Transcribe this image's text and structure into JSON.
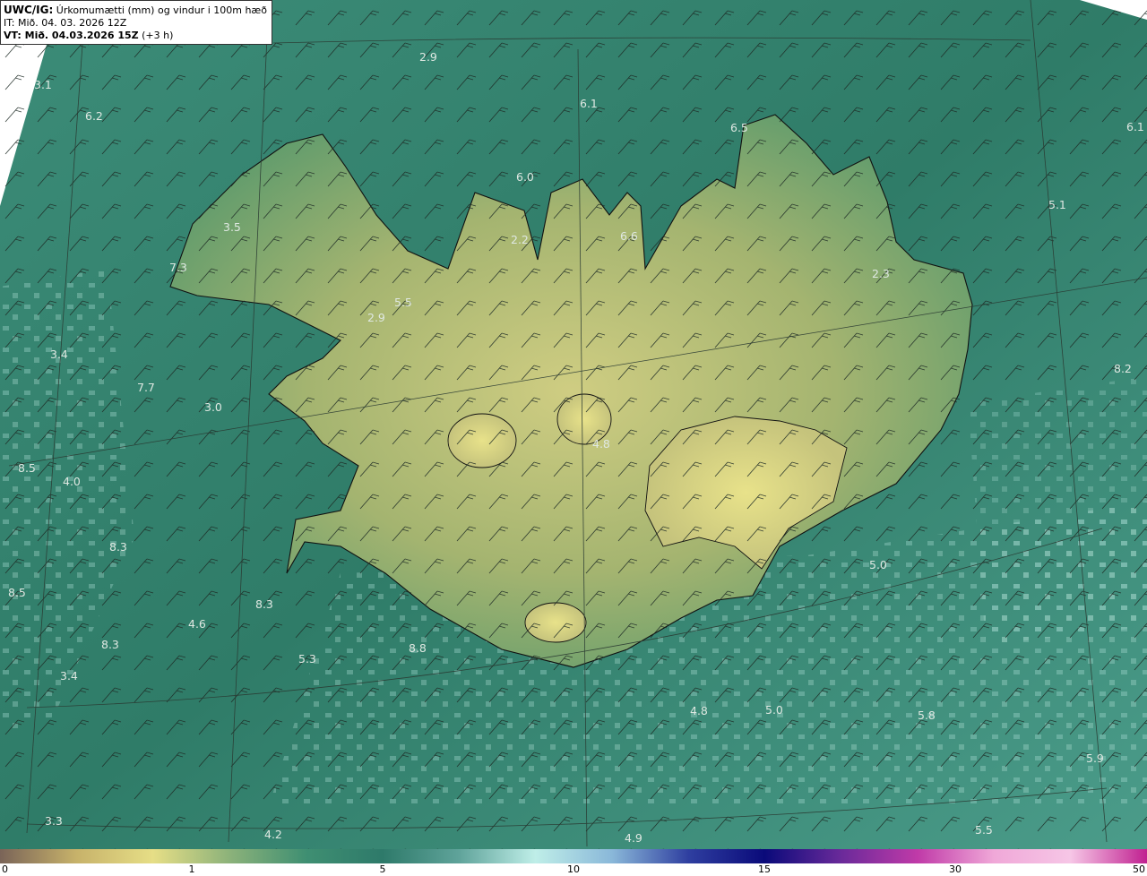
{
  "header": {
    "model": "UWC/IG:",
    "description": "Úrkomumætti (mm) og vindur i 100m hæð",
    "init_time": "IT: Mið. 04. 03. 2026 12Z",
    "valid_prefix": "VT: Mið. 04.03.2026 15Z",
    "valid_suffix": "(+3 h)"
  },
  "map_values": [
    "3.1",
    "6.2",
    "2.9",
    "6.1",
    "6.5",
    "6.1",
    "6.0",
    "5.1",
    "3.5",
    "7.3",
    "2.2",
    "6.6",
    "2.3",
    "5.5",
    "2.9",
    "3.4",
    "8.2",
    "3.0",
    "7.7",
    "4.8",
    "8.5",
    "4.0",
    "8.3",
    "5.0",
    "8.5",
    "4.6",
    "8.3",
    "8.3",
    "8.8",
    "5.3",
    "3.4",
    "4.8",
    "5.0",
    "5.8",
    "5.9",
    "3.3",
    "4.2",
    "4.9",
    "5.5"
  ],
  "colorbar": {
    "ticks": [
      "0",
      "1",
      "5",
      "10",
      "15",
      "30",
      "50"
    ],
    "colors": [
      "#7a6458",
      "#c7b26a",
      "#e6de86",
      "#8cb27a",
      "#3f8f72",
      "#2e7a6a",
      "#5fa39a",
      "#bfeee8",
      "#8ab8d9",
      "#2f3fa0",
      "#0a0a7a",
      "#6a2a9a",
      "#c03aa8",
      "#f0a8d8",
      "#f6c6e6",
      "#c02090"
    ]
  },
  "colors": {
    "ocean": "#3a8a74",
    "land_low": "#5e9a6e",
    "land_high": "#c9c87e",
    "coast": "#111111"
  }
}
